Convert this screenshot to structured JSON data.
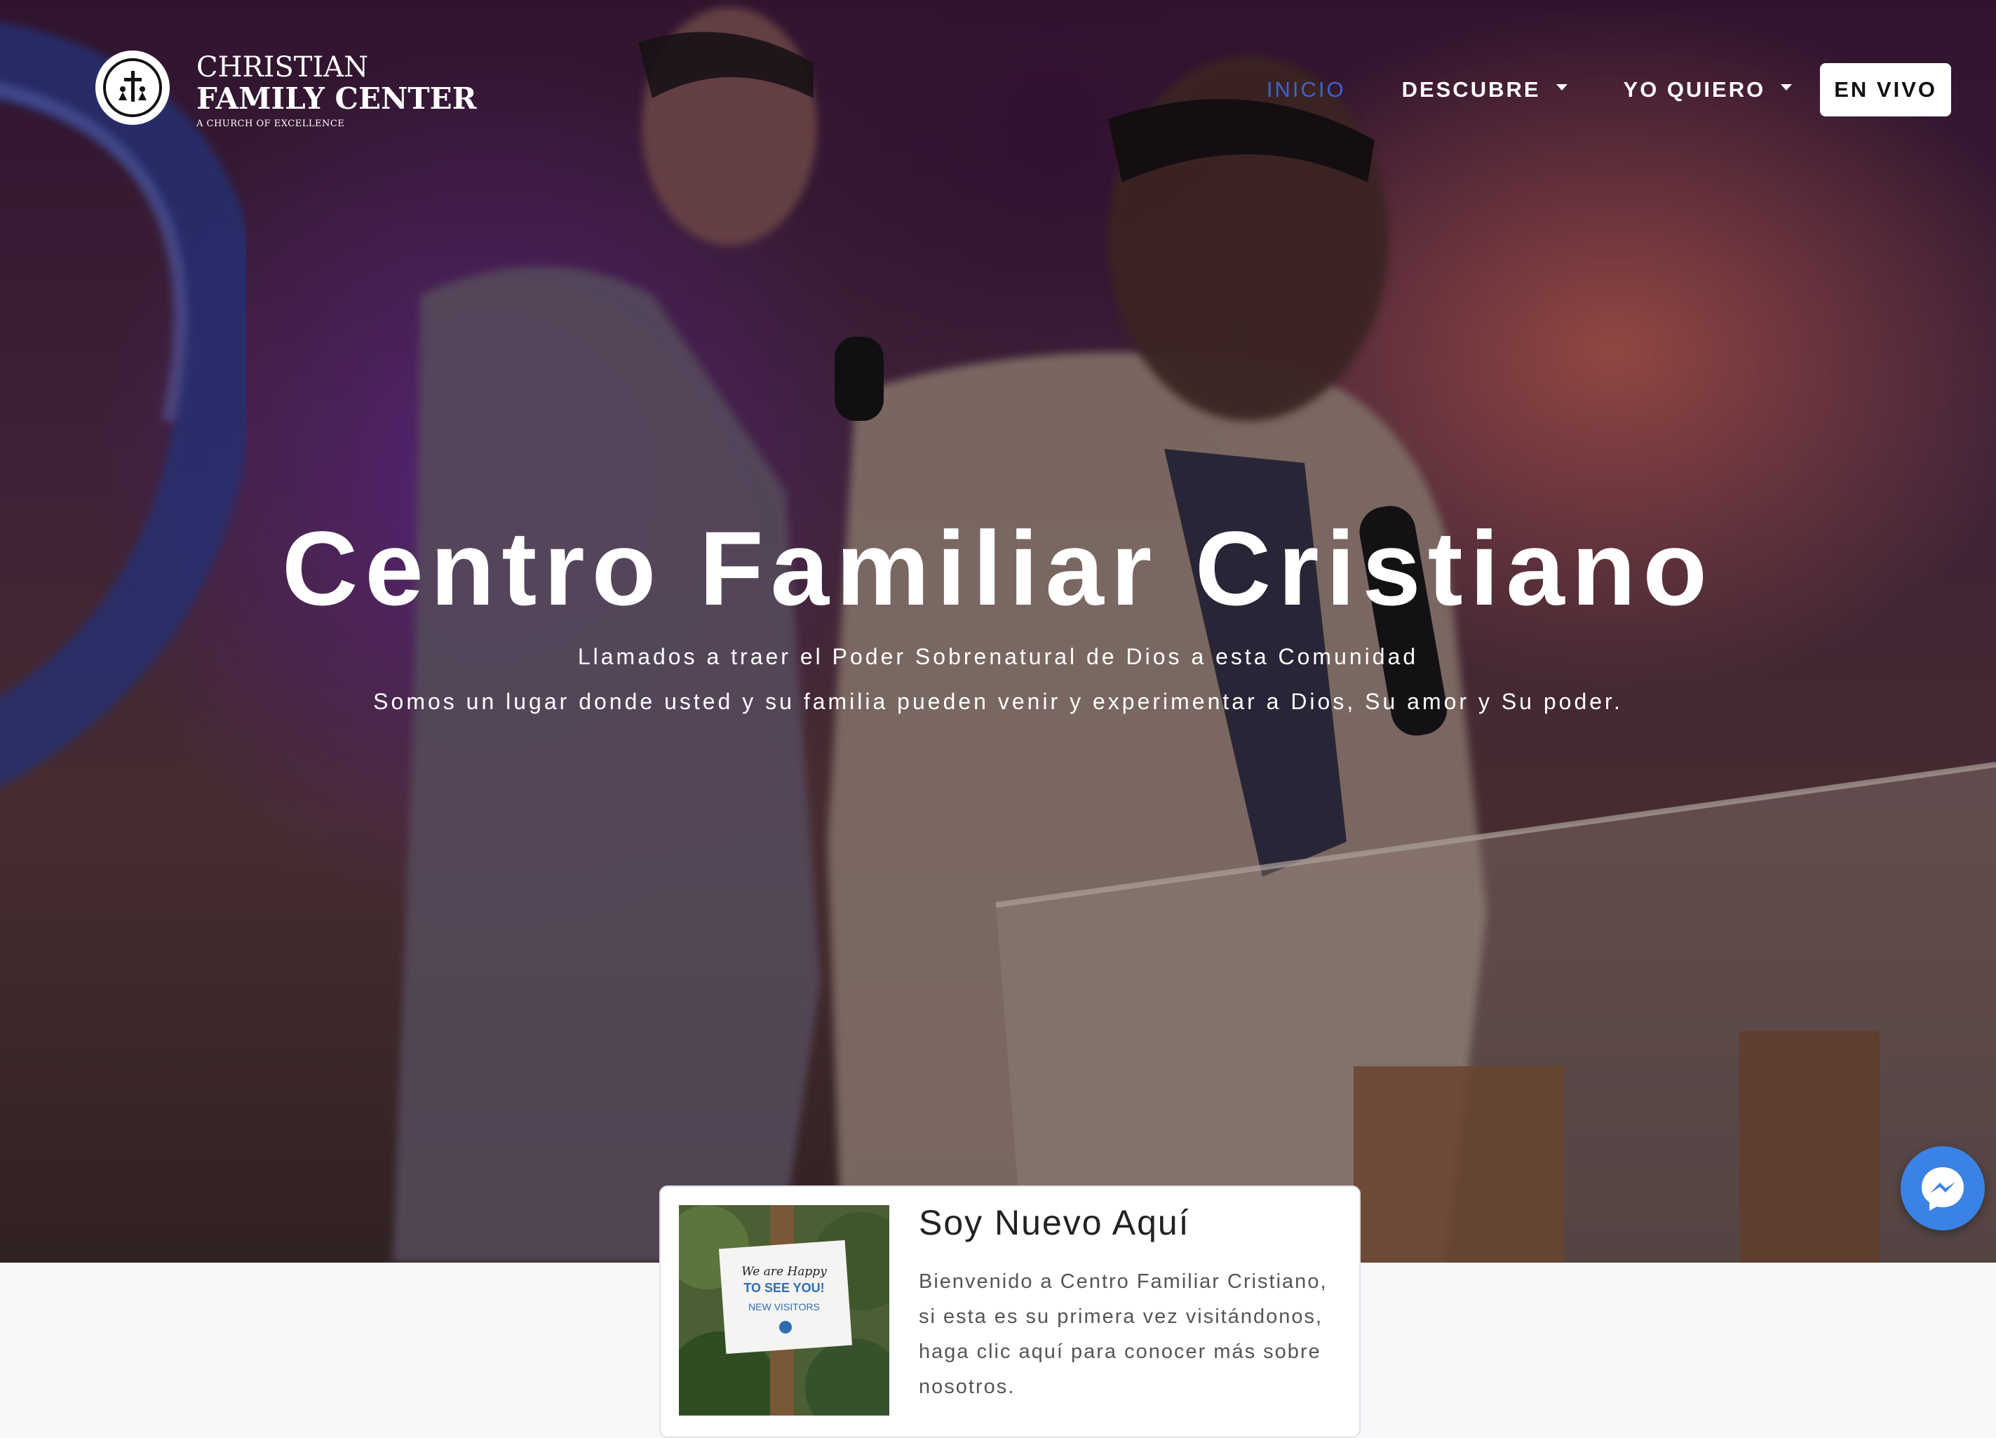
{
  "brand": {
    "line1": "CHRISTIAN",
    "line2": "FAMILY CENTER",
    "tagline": "A CHURCH OF EXCELLENCE"
  },
  "nav": {
    "items": [
      {
        "label": "INICIO",
        "active": true
      },
      {
        "label": "DESCUBRE",
        "dropdown": true
      },
      {
        "label": "YO QUIERO",
        "dropdown": true
      }
    ],
    "live_label": "EN VIVO"
  },
  "hero": {
    "title": "Centro Familiar Cristiano",
    "subtitle1": "Llamados a traer el Poder Sobrenatural de Dios a esta Comunidad",
    "subtitle2": "Somos un lugar donde usted y su familia pueden venir y experimentar a Dios, Su amor y Su poder."
  },
  "card": {
    "title": "Soy Nuevo Aquí",
    "text": "Bienvenido a Centro Familiar Cristiano, si esta es su primera vez visitándonos, haga clic aquí para conocer más sobre nosotros.",
    "sign_line1": "We are Happy",
    "sign_line2": "TO SEE YOU!",
    "sign_line3": "NEW VISITORS"
  },
  "colors": {
    "accent": "#3f63c8",
    "messenger": "#3b82e6"
  },
  "icons": {
    "messenger": "messenger-icon",
    "logo": "church-logo-icon"
  }
}
